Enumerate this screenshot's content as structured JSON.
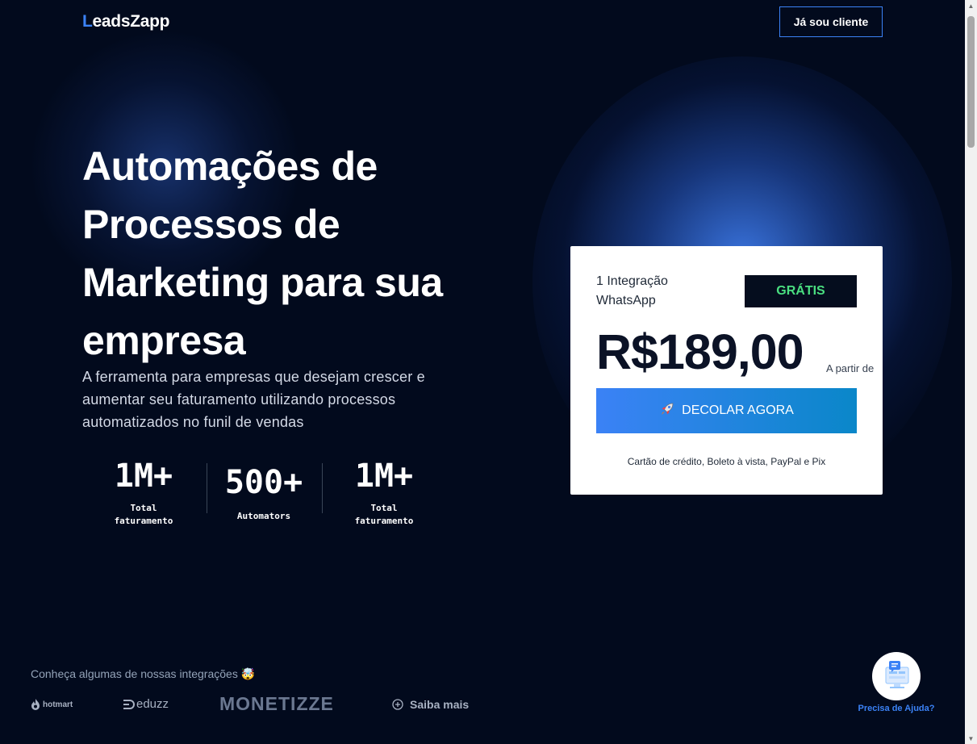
{
  "header": {
    "logo_first_letter": "L",
    "logo_rest": "eadsZapp",
    "client_button": "Já sou cliente"
  },
  "hero": {
    "title": "Automações de Processos de Marketing para sua empresa",
    "subtitle": "A ferramenta para empresas que desejam crescer e aumentar seu faturamento utilizando processos automatizados no funil de vendas"
  },
  "stats": [
    {
      "value": "1M+",
      "label": "Total faturamento"
    },
    {
      "value": "500+",
      "label": "Automators"
    },
    {
      "value": "1M+",
      "label": "Total faturamento"
    }
  ],
  "pricing": {
    "integration": "1 Integração WhatsApp",
    "badge": "GRÁTIS",
    "price": "R$189,00",
    "price_note": "A partir de",
    "cta_icon": "rocket-icon",
    "cta_label": "DECOLAR AGORA",
    "payment_methods": "Cartão de crédito, Boleto à vista, PayPal e Pix"
  },
  "integrations": {
    "title": "Conheça algumas de nossas integrações 🤯",
    "brands": [
      "hotmart",
      "eduzz",
      "MONETIZZE"
    ],
    "more_label": "Saiba mais"
  },
  "help": {
    "label": "Precisa de Ajuda?"
  },
  "colors": {
    "background": "#020a1d",
    "accent": "#3b82f6",
    "badge_text": "#4ade80"
  }
}
